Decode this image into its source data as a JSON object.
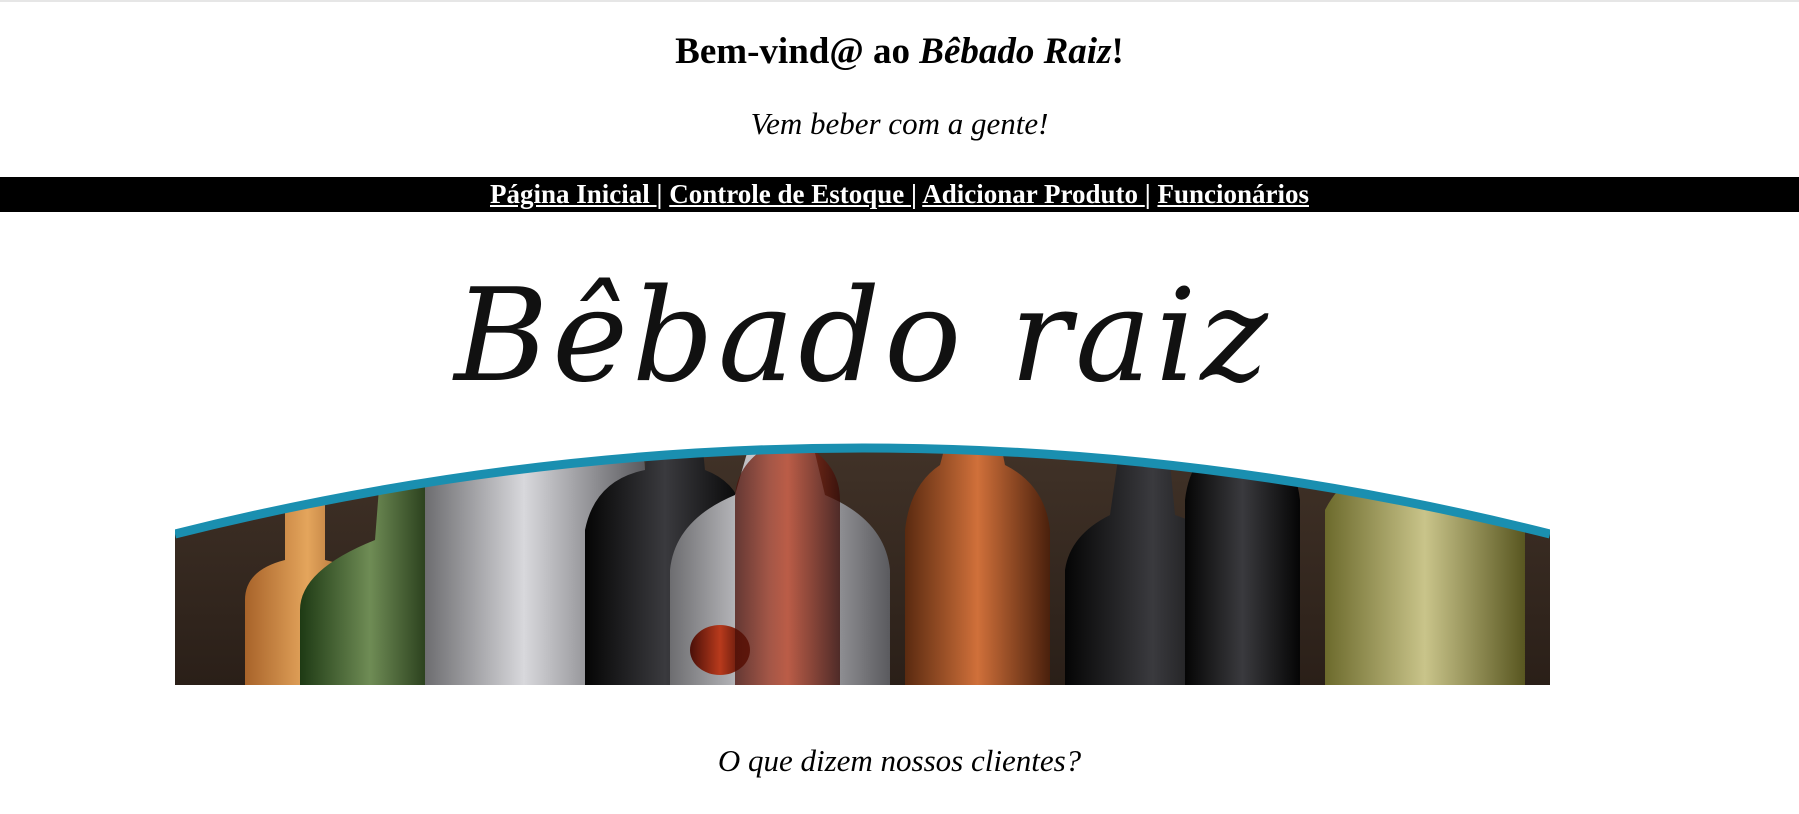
{
  "header": {
    "welcome_prefix": "Bem-vind@ ao ",
    "welcome_brand": "Bêbado Raiz",
    "welcome_suffix": "!",
    "tagline": "Vem beber com a gente!"
  },
  "nav": {
    "items": [
      {
        "label": "Página Inicial "
      },
      {
        "label": "Controle de Estoque "
      },
      {
        "label": "Adicionar Produto "
      },
      {
        "label": "Funcionários"
      }
    ],
    "separator": "|"
  },
  "banner": {
    "logo_text": "Bêbado raiz",
    "accent_color": "#1a8fb0",
    "image_icon": "bottles-banner"
  },
  "main": {
    "clients_heading": "O que dizem nossos clientes?"
  }
}
